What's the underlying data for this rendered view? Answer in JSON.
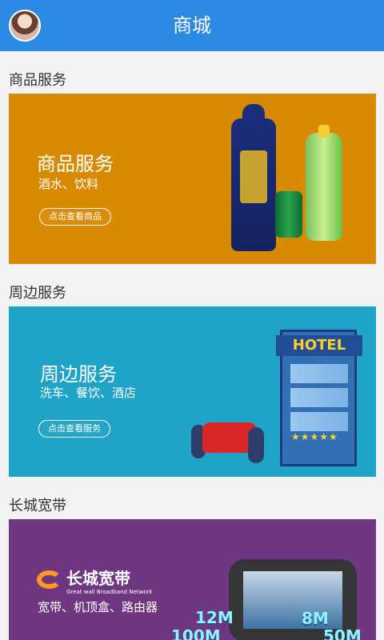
{
  "header": {
    "title": "商城",
    "avatar": "profile-avatar"
  },
  "sections": [
    {
      "heading": "商品服务",
      "banner": {
        "title": "商品服务",
        "subtitle": "酒水、饮料",
        "button": "点击查看商品",
        "accent": "#d98a04",
        "art": "liquor-bottle, soda-can, soft-drink-bottle"
      }
    },
    {
      "heading": "周边服务",
      "banner": {
        "title": "周边服务",
        "subtitle": "洗车、餐饮、酒店",
        "button": "点击查看服务",
        "accent": "#1fa3c6",
        "art": "hotel-building, car-wash",
        "hotel_sign": "HOTEL",
        "stars": "★★★★★"
      }
    },
    {
      "heading": "长城宽带",
      "banner": {
        "brand_name": "长城宽带",
        "brand_en": "Great wall Broadband Network",
        "subtitle": "宽带、机顶盒、路由器",
        "accent": "#6f3782",
        "art": "tv-screen, speed-badges",
        "badges": [
          "12M",
          "8M",
          "50M",
          "100M"
        ]
      }
    }
  ]
}
